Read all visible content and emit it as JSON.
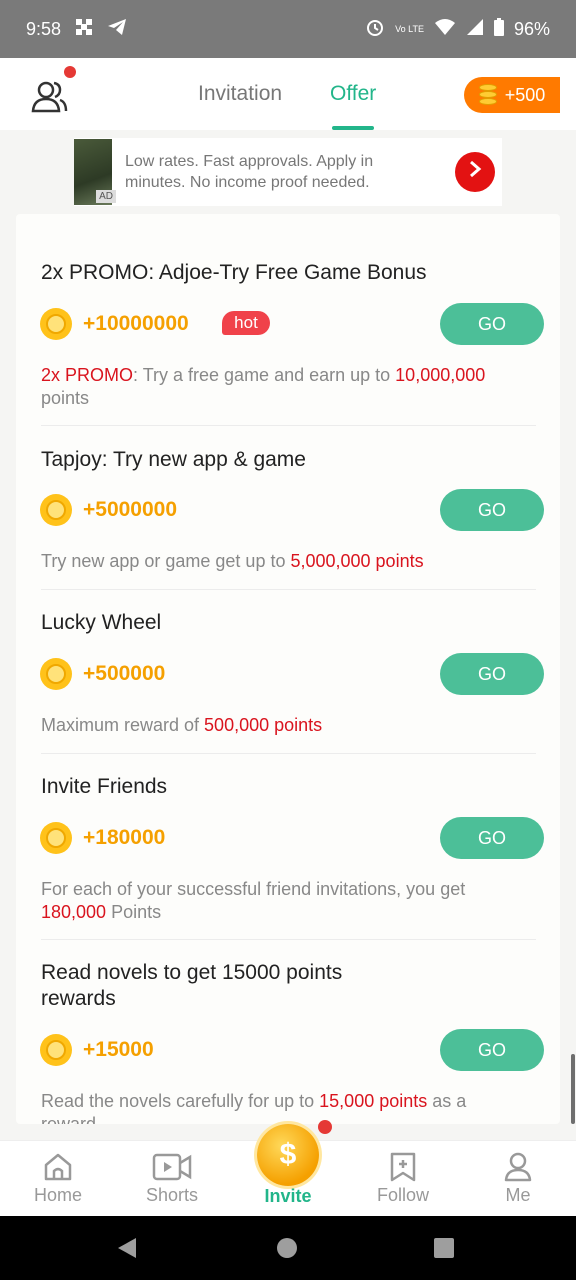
{
  "status_bar": {
    "time": "9:58",
    "battery": "96%",
    "network_label": "Vo LTE"
  },
  "header": {
    "tabs": [
      {
        "label": "Invitation",
        "active": false
      },
      {
        "label": "Offer",
        "active": true
      }
    ],
    "points_badge": "+500",
    "accent_color": "#22b58a"
  },
  "ad": {
    "text": "Low rates. Fast approvals. Apply in minutes. No income proof needed.",
    "thumb_label": "AD"
  },
  "offers": [
    {
      "title": "2x PROMO: Adjoe-Try Free Game Bonus",
      "points": "+10000000",
      "badge": "hot",
      "button": "GO",
      "desc_parts": [
        {
          "text": "2x PROMO",
          "highlight": true
        },
        {
          "text": ": Try a free game and earn up to ",
          "highlight": false
        },
        {
          "text": "10,000,000",
          "highlight": true
        },
        {
          "text": " points",
          "highlight": false
        }
      ]
    },
    {
      "title": "Tapjoy: Try new app & game",
      "points": "+5000000",
      "button": "GO",
      "desc_parts": [
        {
          "text": "Try new app or game get up to ",
          "highlight": false
        },
        {
          "text": "5,000,000 points",
          "highlight": true
        }
      ]
    },
    {
      "title": "Lucky Wheel",
      "points": "+500000",
      "button": "GO",
      "desc_parts": [
        {
          "text": "Maximum reward of ",
          "highlight": false
        },
        {
          "text": "500,000 points",
          "highlight": true
        }
      ]
    },
    {
      "title": "Invite Friends",
      "points": "+180000",
      "button": "GO",
      "desc_parts": [
        {
          "text": "For each of your successful friend invitations, you get ",
          "highlight": false
        },
        {
          "text": "180,000",
          "highlight": true
        },
        {
          "text": " Points",
          "highlight": false
        }
      ]
    },
    {
      "title": "Read novels to get 15000 points rewards",
      "points": "+15000",
      "button": "GO",
      "desc_parts": [
        {
          "text": "Read the novels carefully for up to ",
          "highlight": false
        },
        {
          "text": "15,000 points",
          "highlight": true
        },
        {
          "text": " as a reward",
          "highlight": false
        }
      ]
    }
  ],
  "bottom_nav": [
    {
      "label": "Home",
      "icon": "home-icon"
    },
    {
      "label": "Shorts",
      "icon": "video-icon"
    },
    {
      "label": "Invite",
      "icon": "dollar-coin-icon",
      "active": true
    },
    {
      "label": "Follow",
      "icon": "bookmark-plus-icon"
    },
    {
      "label": "Me",
      "icon": "person-icon"
    }
  ],
  "colors": {
    "green": "#22b58a",
    "button_green": "#4cbf98",
    "gold": "#f5a000",
    "red": "#d9141e",
    "orange": "#ff7a00"
  }
}
